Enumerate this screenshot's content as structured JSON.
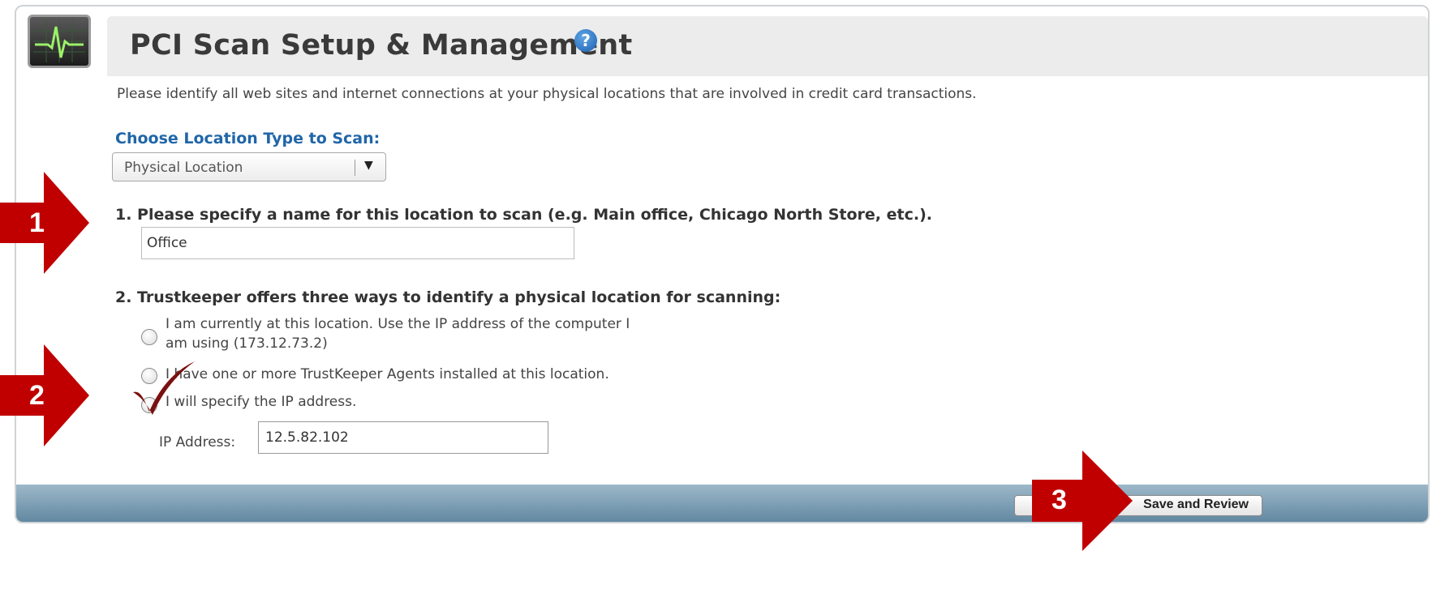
{
  "header": {
    "title": "PCI Scan Setup & Management",
    "help_icon": "question-mark-icon"
  },
  "intro": "Please identify all web sites and internet connections at your physical locations that are involved in credit card transactions.",
  "location_type": {
    "label": "Choose Location Type to Scan:",
    "selected": "Physical Location"
  },
  "question1": {
    "label": "1. Please specify a name for this location to scan (e.g. Main office, Chicago North Store, etc.).",
    "value": "Office"
  },
  "question2": {
    "label": "2. Trustkeeper offers three ways to identify a physical location for scanning:",
    "options": [
      {
        "line1": "I am currently at this location. Use the IP address of the computer I",
        "line2": "am using (173.12.73.2)"
      },
      {
        "line1": "I have one or more TrustKeeper Agents installed at this location."
      },
      {
        "line1": "I will specify the IP address."
      }
    ],
    "ip_label": "IP Address:",
    "ip_value": "12.5.82.102"
  },
  "footer": {
    "save_label": "Save and Review"
  },
  "annotations": {
    "step1": "1",
    "step2": "2",
    "step3": "3",
    "arrow_color": "#c00000",
    "check_color": "#7a1010"
  }
}
